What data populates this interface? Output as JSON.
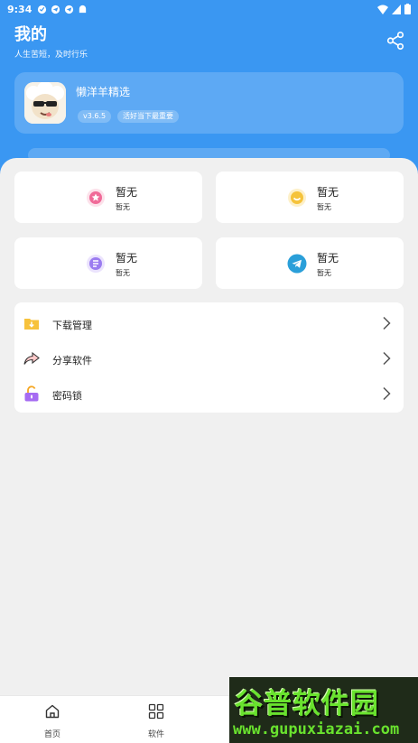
{
  "status_bar": {
    "time": "9:34"
  },
  "header": {
    "title": "我的",
    "subtitle": "人生苦短，及时行乐"
  },
  "app_card": {
    "name": "懒洋羊精选",
    "version": "v3.6.5",
    "motto": "活好当下最重要"
  },
  "grid": [
    {
      "title": "暂无",
      "subtitle": "暂无",
      "icon": "star-badge-icon",
      "color": "#f06a98"
    },
    {
      "title": "暂无",
      "subtitle": "暂无",
      "icon": "smile-badge-icon",
      "color": "#f5c33b"
    },
    {
      "title": "暂无",
      "subtitle": "暂无",
      "icon": "document-badge-icon",
      "color": "#9b7cf0"
    },
    {
      "title": "暂无",
      "subtitle": "暂无",
      "icon": "telegram-icon",
      "color": "#2a9fd9"
    }
  ],
  "menu": [
    {
      "label": "下载管理",
      "icon": "download-folder-icon"
    },
    {
      "label": "分享软件",
      "icon": "share-arrow-icon"
    },
    {
      "label": "密码锁",
      "icon": "unlock-icon"
    }
  ],
  "bottom_nav": [
    {
      "label": "首页",
      "icon": "home-icon"
    },
    {
      "label": "软件",
      "icon": "grid-icon"
    }
  ],
  "watermark": {
    "title": "谷普软件园",
    "url": "www.gupuxiazai.com"
  },
  "colors": {
    "primary": "#3a97f2",
    "background": "#f0f0f0",
    "card": "#ffffff"
  }
}
